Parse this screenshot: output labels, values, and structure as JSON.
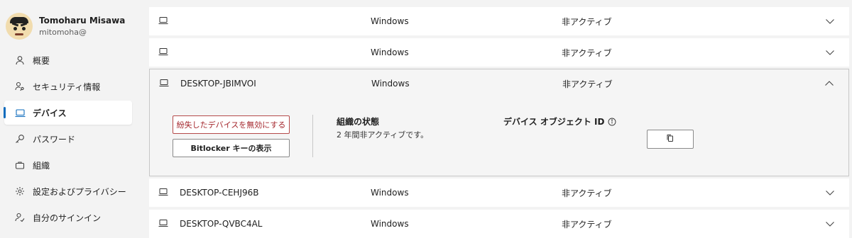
{
  "profile": {
    "name": "Tomoharu Misawa",
    "email": "mitomoha@"
  },
  "nav": {
    "items": [
      {
        "label": "概要",
        "icon": "person-icon"
      },
      {
        "label": "セキュリティ情報",
        "icon": "security-info-icon"
      },
      {
        "label": "デバイス",
        "icon": "laptop-icon",
        "active": true
      },
      {
        "label": "パスワード",
        "icon": "key-icon"
      },
      {
        "label": "組織",
        "icon": "briefcase-icon"
      },
      {
        "label": "設定およびプライバシー",
        "icon": "gear-icon"
      },
      {
        "label": "自分のサインイン",
        "icon": "sign-ins-icon"
      }
    ]
  },
  "devices": [
    {
      "name": "",
      "os": "Windows",
      "status": "非アクティブ",
      "expanded": false
    },
    {
      "name": "",
      "os": "Windows",
      "status": "非アクティブ",
      "expanded": false
    },
    {
      "name": "DESKTOP-JBIMVOI",
      "os": "Windows",
      "status": "非アクティブ",
      "expanded": true
    },
    {
      "name": "DESKTOP-CEHJ96B",
      "os": "Windows",
      "status": "非アクティブ",
      "expanded": false
    },
    {
      "name": "DESKTOP-QVBC4AL",
      "os": "Windows",
      "status": "非アクティブ",
      "expanded": false
    }
  ],
  "detail": {
    "disable_button": "紛失したデバイスを無効にする",
    "bitlocker_button": "Bitlocker キーの表示",
    "org_state_title": "組織の状態",
    "org_state_value": "2 年間非アクティブです。",
    "object_id_title": "デバイス オブジェクト ID"
  },
  "colors": {
    "accent": "#0f6cbd",
    "danger": "#a4262c"
  }
}
